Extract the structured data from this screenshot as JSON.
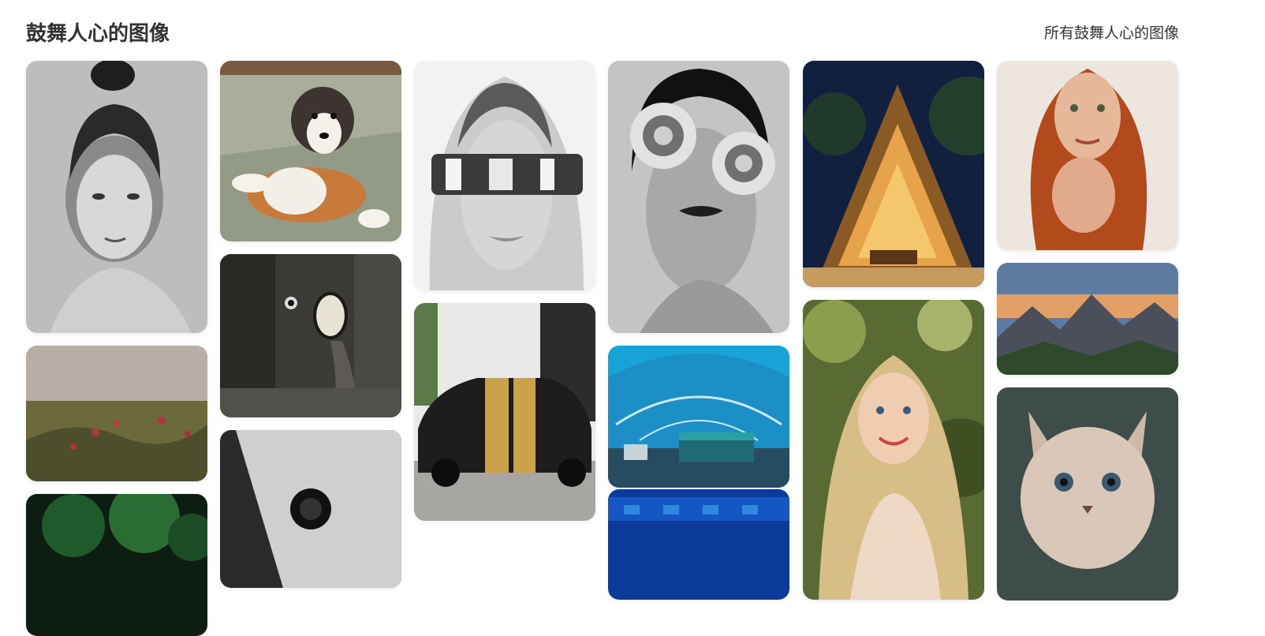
{
  "header": {
    "title": "鼓舞人心的图像",
    "all_link": "所有鼓舞人心的图像"
  },
  "images": [
    {
      "subject": "woman-updo-bw"
    },
    {
      "subject": "australian-shepherd-puppy"
    },
    {
      "subject": "woman-mirror-visor"
    },
    {
      "subject": "woman-soda-can-eyes"
    },
    {
      "subject": "thatched-hut-night"
    },
    {
      "subject": "redhead-freckles"
    },
    {
      "subject": "poppy-field"
    },
    {
      "subject": "forest-mirror-scene"
    },
    {
      "subject": "black-muscle-car"
    },
    {
      "subject": "underwater-hotel-room"
    },
    {
      "subject": "smiling-blonde-woman"
    },
    {
      "subject": "mountain-sunset"
    },
    {
      "subject": "night-garden"
    },
    {
      "subject": "camera-lens-paper"
    },
    {
      "subject": "underwater-restaurant"
    },
    {
      "subject": "fluffy-kitten"
    }
  ]
}
